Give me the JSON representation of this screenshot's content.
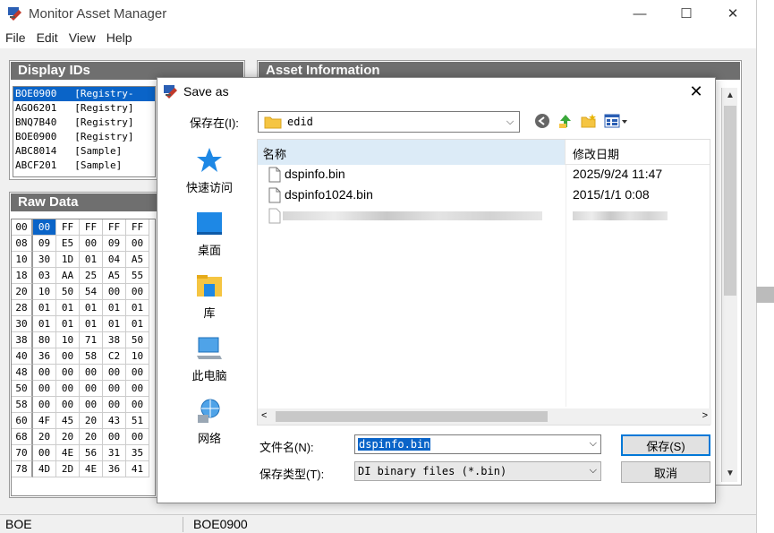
{
  "window": {
    "title": "Monitor Asset Manager",
    "controls": {
      "minimize": "—",
      "maximize": "☐",
      "close": "✕"
    }
  },
  "menu": [
    "File",
    "Edit",
    "View",
    "Help"
  ],
  "panels": {
    "display_ids_header": "Display IDs",
    "asset_info_header": "Asset Information",
    "raw_data_header": "Raw Data"
  },
  "display_ids": [
    "BOE0900   [Registry-",
    "AGO6201   [Registry]",
    "BNQ7B40   [Registry]",
    "BOE0900   [Registry]",
    "ABC8014   [Sample]",
    "ABCF201   [Sample]"
  ],
  "raw_data": [
    [
      "00",
      "00",
      "FF",
      "FF",
      "FF",
      "FF"
    ],
    [
      "08",
      "09",
      "E5",
      "00",
      "09",
      "00"
    ],
    [
      "10",
      "30",
      "1D",
      "01",
      "04",
      "A5"
    ],
    [
      "18",
      "03",
      "AA",
      "25",
      "A5",
      "55"
    ],
    [
      "20",
      "10",
      "50",
      "54",
      "00",
      "00"
    ],
    [
      "28",
      "01",
      "01",
      "01",
      "01",
      "01"
    ],
    [
      "30",
      "01",
      "01",
      "01",
      "01",
      "01"
    ],
    [
      "38",
      "80",
      "10",
      "71",
      "38",
      "50"
    ],
    [
      "40",
      "36",
      "00",
      "58",
      "C2",
      "10"
    ],
    [
      "48",
      "00",
      "00",
      "00",
      "00",
      "00"
    ],
    [
      "50",
      "00",
      "00",
      "00",
      "00",
      "00"
    ],
    [
      "58",
      "00",
      "00",
      "00",
      "00",
      "00"
    ],
    [
      "60",
      "4F",
      "45",
      "20",
      "43",
      "51"
    ],
    [
      "68",
      "20",
      "20",
      "20",
      "00",
      "00"
    ],
    [
      "70",
      "00",
      "4E",
      "56",
      "31",
      "35"
    ],
    [
      "78",
      "4D",
      "2D",
      "4E",
      "36",
      "41"
    ]
  ],
  "status": {
    "left": "BOE",
    "right": "BOE0900"
  },
  "dialog": {
    "title": "Save as",
    "save_in_label": "保存在(I):",
    "save_in_value": "edid",
    "places": [
      "快速访问",
      "桌面",
      "库",
      "此电脑",
      "网络"
    ],
    "columns": {
      "name": "名称",
      "date": "修改日期"
    },
    "files": [
      {
        "name": "dspinfo.bin",
        "date": "2025/9/24 11:47"
      },
      {
        "name": "dspinfo1024.bin",
        "date": "2015/1/1 0:08"
      }
    ],
    "filename_label": "文件名(N):",
    "filename_value": "dspinfo.bin",
    "filetype_label": "保存类型(T):",
    "filetype_value": "DI binary files (*.bin)",
    "save_button": "保存(S)",
    "cancel_button": "取消"
  }
}
